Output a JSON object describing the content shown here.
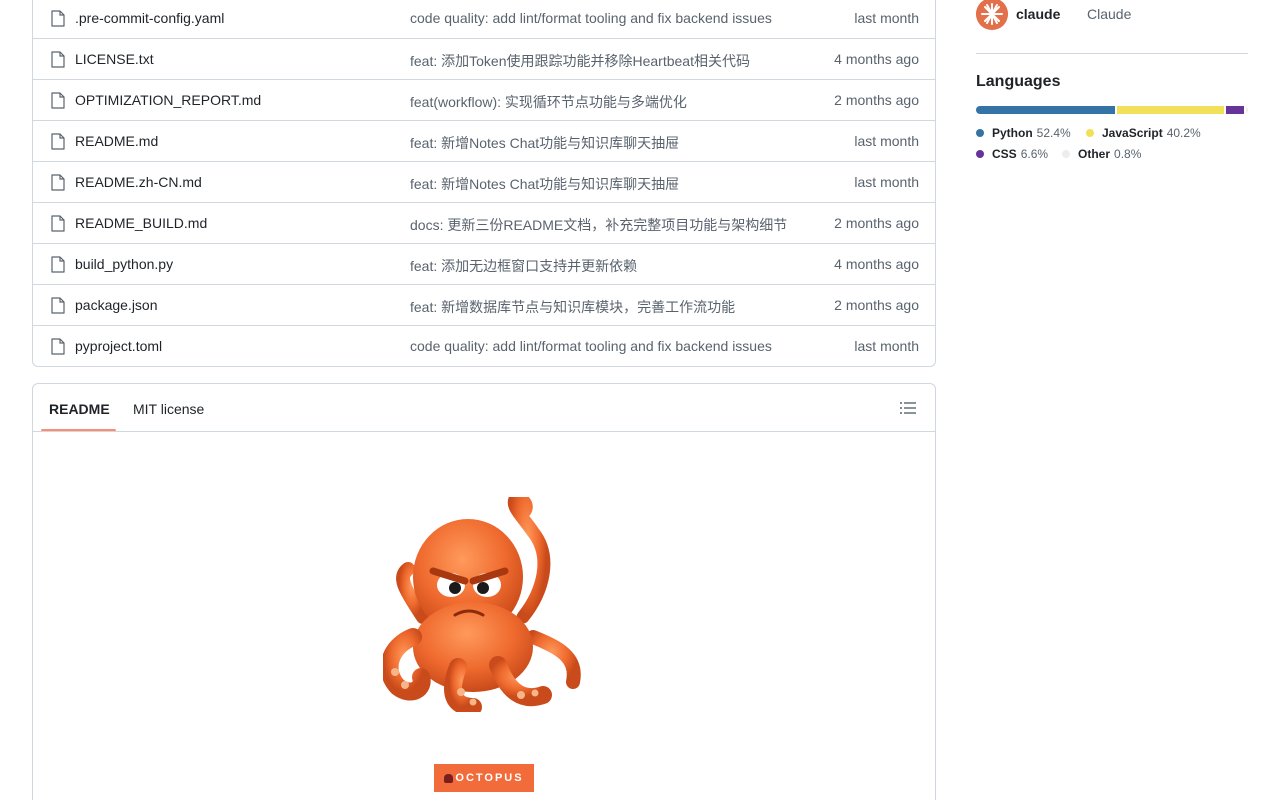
{
  "files": [
    {
      "name": ".pre-commit-config.yaml",
      "message": "code quality: add lint/format tooling and fix backend issues",
      "date": "last month"
    },
    {
      "name": "LICENSE.txt",
      "message": "feat: 添加Token使用跟踪功能并移除Heartbeat相关代码",
      "date": "4 months ago"
    },
    {
      "name": "OPTIMIZATION_REPORT.md",
      "message": "feat(workflow): 实现循环节点功能与多端优化",
      "date": "2 months ago"
    },
    {
      "name": "README.md",
      "message": "feat: 新增Notes Chat功能与知识库聊天抽屉",
      "date": "last month"
    },
    {
      "name": "README.zh-CN.md",
      "message": "feat: 新增Notes Chat功能与知识库聊天抽屉",
      "date": "last month"
    },
    {
      "name": "README_BUILD.md",
      "message": "docs: 更新三份README文档，补充完整项目功能与架构细节",
      "date": "2 months ago"
    },
    {
      "name": "build_python.py",
      "message": "feat: 添加无边框窗口支持并更新依赖",
      "date": "4 months ago"
    },
    {
      "name": "package.json",
      "message": "feat: 新增数据库节点与知识库模块，完善工作流功能",
      "date": "2 months ago"
    },
    {
      "name": "pyproject.toml",
      "message": "code quality: add lint/format tooling and fix backend issues",
      "date": "last month"
    }
  ],
  "readme": {
    "tab_readme": "README",
    "tab_license": "MIT license",
    "badge_text": "OCTOPUS"
  },
  "sidebar": {
    "contributor": {
      "login": "claude",
      "name": "Claude"
    },
    "languages_title": "Languages",
    "languages": [
      {
        "name": "Python",
        "percent": "52.4%",
        "value": 52.4,
        "color": "#3572A5"
      },
      {
        "name": "JavaScript",
        "percent": "40.2%",
        "value": 40.2,
        "color": "#f1e05a"
      },
      {
        "name": "CSS",
        "percent": "6.6%",
        "value": 6.6,
        "color": "#663399"
      },
      {
        "name": "Other",
        "percent": "0.8%",
        "value": 0.8,
        "color": "#ededed"
      }
    ]
  }
}
